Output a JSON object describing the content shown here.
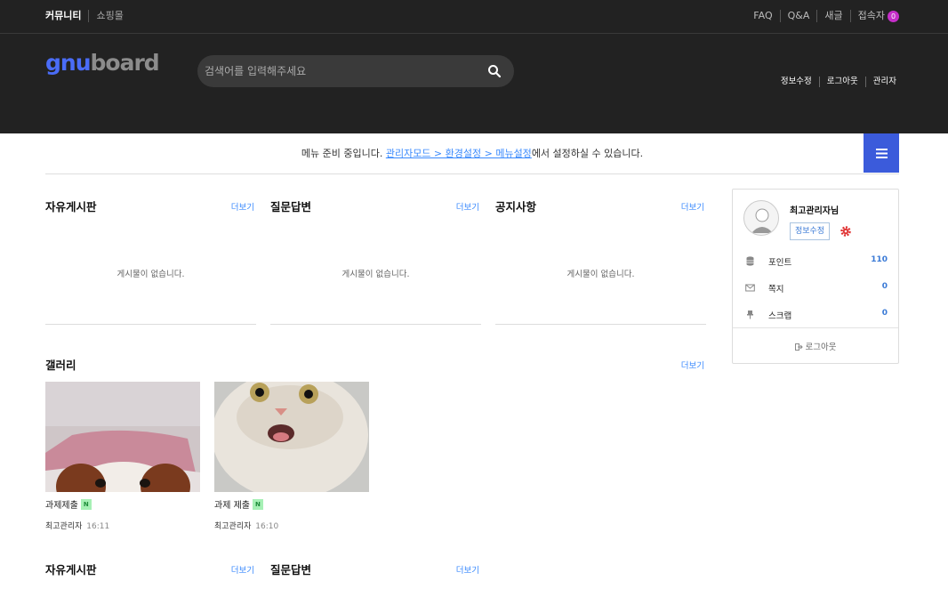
{
  "topbar": {
    "left_links": [
      "커뮤니티",
      "쇼핑몰"
    ],
    "right_links": [
      "FAQ",
      "Q&A",
      "새글"
    ],
    "visitors_label": "접속자",
    "visitors_count": "0"
  },
  "header": {
    "logo_part1": "gnu",
    "logo_part2": "board",
    "search_placeholder": "검색어를 입력해주세요",
    "user_nav": [
      "정보수정",
      "로그아웃",
      "관리자"
    ]
  },
  "notice": {
    "prefix": "메뉴 준비 중입니다. ",
    "link": "관리자모드 > 환경설정 > 메뉴설정",
    "suffix": "에서 설정하실 수 있습니다."
  },
  "boards": [
    {
      "title": "자유게시판",
      "more": "더보기",
      "empty": "게시물이 없습니다."
    },
    {
      "title": "질문답변",
      "more": "더보기",
      "empty": "게시물이 없습니다."
    },
    {
      "title": "공지사항",
      "more": "더보기",
      "empty": "게시물이 없습니다."
    }
  ],
  "gallery": {
    "title": "갤러리",
    "more": "더보기",
    "items": [
      {
        "title": "과제제출",
        "badge": "N",
        "author": "최고관리자",
        "time": "16:11"
      },
      {
        "title": "과제 제출",
        "badge": "N",
        "author": "최고관리자",
        "time": "16:10"
      }
    ]
  },
  "bottom_boards": [
    {
      "title": "자유게시판",
      "more": "더보기"
    },
    {
      "title": "질문답변",
      "more": "더보기"
    }
  ],
  "profile": {
    "name": "최고관리자님",
    "edit_label": "정보수정",
    "stats": [
      {
        "icon": "database-icon",
        "label": "포인트",
        "value": "110"
      },
      {
        "icon": "envelope-icon",
        "label": "쪽지",
        "value": "0"
      },
      {
        "icon": "pin-icon",
        "label": "스크랩",
        "value": "0"
      }
    ],
    "logout_label": "로그아웃"
  },
  "colors": {
    "accent": "#3b5bdb",
    "link": "#3a8afd",
    "header_bg": "#222222"
  }
}
